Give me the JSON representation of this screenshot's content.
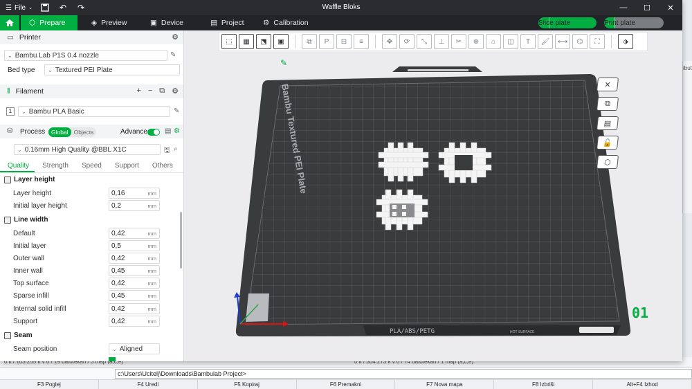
{
  "window": {
    "title": "Waffle Bloks",
    "file_menu": "File"
  },
  "tabs": [
    {
      "label": "Prepare",
      "active": true
    },
    {
      "label": "Preview"
    },
    {
      "label": "Device"
    },
    {
      "label": "Project"
    },
    {
      "label": "Calibration"
    }
  ],
  "actions": {
    "slice_label": "Slice plate",
    "print_label": "Print plate"
  },
  "printer": {
    "section_label": "Printer",
    "model": "Bambu Lab P1S 0.4 nozzle",
    "bed_type_label": "Bed type",
    "bed_type": "Textured PEI Plate"
  },
  "filament": {
    "section_label": "Filament",
    "slot": "1",
    "name": "Bambu PLA Basic"
  },
  "process": {
    "section_label": "Process",
    "toggle_global": "Global",
    "toggle_objects": "Objects",
    "advance_label": "Advance",
    "preset": "0.16mm High Quality @BBL X1C",
    "tabs": [
      "Quality",
      "Strength",
      "Speed",
      "Support",
      "Others"
    ]
  },
  "quality": {
    "layer_height_group": "Layer height",
    "layer_height_label": "Layer height",
    "layer_height": "0,16",
    "initial_layer_height_label": "Initial layer height",
    "initial_layer_height": "0,2",
    "line_width_group": "Line width",
    "default_label": "Default",
    "default": "0,42",
    "initial_layer_label": "Initial layer",
    "initial_layer": "0,5",
    "outer_wall_label": "Outer wall",
    "outer_wall": "0,42",
    "inner_wall_label": "Inner wall",
    "inner_wall": "0,45",
    "top_surface_label": "Top surface",
    "top_surface": "0,42",
    "sparse_infill_label": "Sparse infill",
    "sparse_infill": "0,45",
    "internal_solid_infill_label": "Internal solid infill",
    "internal_solid_infill": "0,42",
    "support_label": "Support",
    "support": "0,42",
    "seam_group": "Seam",
    "seam_position_label": "Seam position",
    "seam_position": "Aligned",
    "unit": "mm"
  },
  "bed": {
    "plate_text": "Bambu Textured PEI Plate",
    "material_text": "PLA/ABS/PETG",
    "hot_text": "HOT SURFACE",
    "plate_number": "01"
  },
  "background": {
    "status_left": "0 k / 103.255 k v 0 / 19 datotekah / 3 map (a,c,e)",
    "status_right": "0 k / 304.273 k v 0 / 74 datotekah / 1 map (a,c,e)",
    "path": "c:\\Users\\Ucitelj\\Downloads\\Bambulab Project>",
    "side_label": "ibut",
    "fkeys": [
      "F3 Poglej",
      "F4 Uredi",
      "F5 Kopiraj",
      "F6 Premakni",
      "F7 Nova mapa",
      "F8 Izbriši",
      "Alt+F4 Izhod"
    ]
  },
  "colors": {
    "accent": "#00ae42",
    "titlebar": "#2b2c30",
    "bed": "#3a3b3d"
  }
}
